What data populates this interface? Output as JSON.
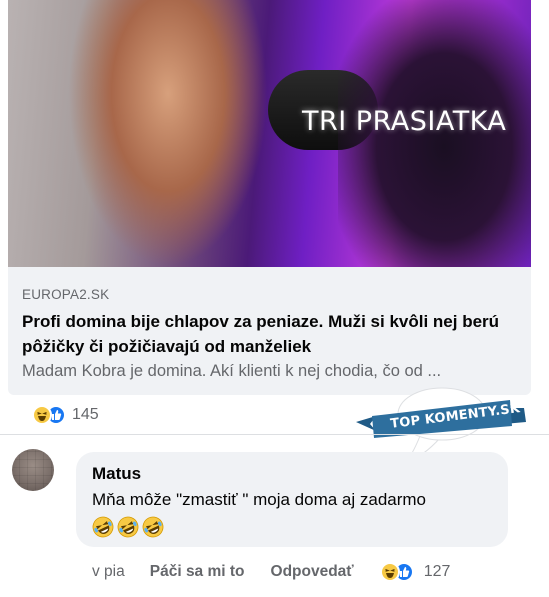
{
  "post_link": {
    "image_overlay_text": "TRI PRASIATKA",
    "domain": "EUROPA2.SK",
    "headline": "Profi domina bije chlapov za peniaze. Muži si kvôli nej berú pôžičky či požičiavajú od manželiek",
    "description": "Madam Kobra je domina. Akí klienti k nej chodia, čo od ..."
  },
  "post_reactions": {
    "icons": [
      "haha-icon",
      "like-icon"
    ],
    "count": "145"
  },
  "badge": {
    "text": "TOP KOMENTY.SK",
    "color": "#2e6f9e"
  },
  "comment": {
    "author": "Matus",
    "text": "Mňa môže \"zmastiť \" moja doma aj zadarmo",
    "emojis": [
      "rofl-icon",
      "rofl-icon",
      "rofl-icon"
    ],
    "time": "v pia",
    "like_label": "Páči sa mi to",
    "reply_label": "Odpovedať",
    "reaction_icons": [
      "haha-icon",
      "like-icon"
    ],
    "reaction_count": "127"
  },
  "colors": {
    "bubble_bg": "#f0f2f5",
    "secondary_text": "#65676b",
    "like_blue": "#1877f2",
    "haha_yellow": "#f7c944"
  }
}
